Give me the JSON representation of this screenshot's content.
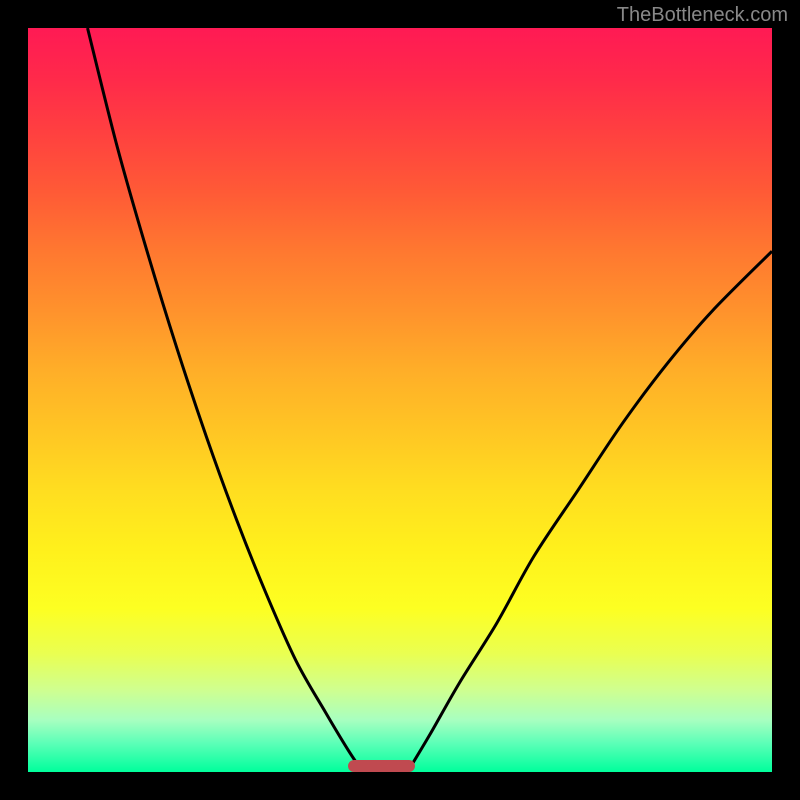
{
  "watermark": "TheBottleneck.com",
  "chart_data": {
    "type": "line",
    "title": "",
    "xlabel": "",
    "ylabel": "",
    "xlim": [
      0,
      100
    ],
    "ylim": [
      0,
      100
    ],
    "background_gradient": {
      "top": "#ff1a54",
      "bottom": "#00ff9c",
      "stops": [
        "red",
        "orange",
        "yellow",
        "green"
      ]
    },
    "series": [
      {
        "name": "left-curve",
        "x": [
          8,
          12,
          16,
          20,
          24,
          28,
          32,
          36,
          40,
          43,
          45
        ],
        "y": [
          100,
          84,
          70,
          57,
          45,
          34,
          24,
          15,
          8,
          3,
          0
        ]
      },
      {
        "name": "right-curve",
        "x": [
          51,
          54,
          58,
          63,
          68,
          74,
          80,
          86,
          92,
          100
        ],
        "y": [
          0,
          5,
          12,
          20,
          29,
          38,
          47,
          55,
          62,
          70
        ]
      }
    ],
    "marker": {
      "x_start": 43,
      "x_end": 52,
      "y": 0,
      "color": "#c04a50"
    }
  }
}
